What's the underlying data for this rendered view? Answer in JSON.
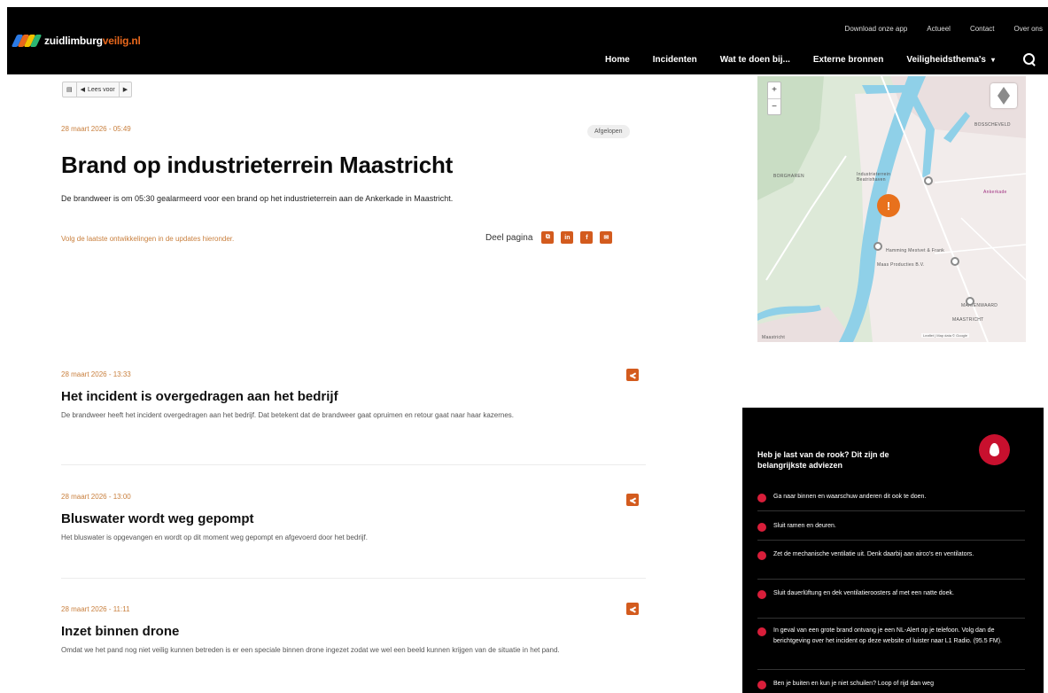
{
  "header": {
    "logo_main": "zuidlimburg",
    "logo_accent": "veilig.nl",
    "util_nav": [
      "Download onze app",
      "Actueel",
      "Contact",
      "Over ons"
    ],
    "main_nav": [
      "Home",
      "Incidenten",
      "Wat te doen bij...",
      "Externe bronnen",
      "Veiligheidsthema's"
    ]
  },
  "read_aloud": {
    "label": "Lees voor"
  },
  "article": {
    "date": "28 maart 2026 - 05:49",
    "status_tag": "Afgelopen",
    "title": "Brand op industrieterrein Maastricht",
    "lead": "De brandweer is om 05:30 gealarmeerd voor een brand op het industrieterrein aan de Ankerkade in Maastricht.",
    "follow_text": "Volg de laatste ontwikkelingen in de updates hieronder.",
    "share_label": "Deel pagina",
    "share_buttons": [
      "copy",
      "linkedin",
      "facebook",
      "mail"
    ]
  },
  "updates": [
    {
      "date": "28 maart 2026 - 13:33",
      "title": "Het incident is overgedragen aan het bedrijf",
      "text": "De brandweer heeft het incident overgedragen aan het bedrijf. Dat betekent dat de brandweer gaat opruimen en retour gaat naar haar kazernes."
    },
    {
      "date": "28 maart 2026 - 13:00",
      "title": "Bluswater wordt weg gepompt",
      "text": "Het bluswater is opgevangen en wordt op dit moment weg gepompt en afgevoerd door het bedrijf."
    },
    {
      "date": "28 maart 2026 - 11:11",
      "title": "Inzet binnen drone",
      "text": "Omdat we het pand nog niet veilig kunnen betreden is er een speciale binnen drone ingezet zodat we wel een beeld kunnen krijgen van de situatie in het pand."
    }
  ],
  "map": {
    "zoom_in": "+",
    "zoom_out": "−",
    "labels": [
      "BOSSCHEVELD",
      "BORGHAREN",
      "Maastricht",
      "Ankerkade",
      "MARIENWAARD",
      "MAASTRICHT"
    ],
    "pois": [
      "Industrieterrein Beatrixhaven",
      "Hamming Mestvet & Frank",
      "Maas Producties B.V."
    ],
    "attribution": "Leaflet | Map data © Google",
    "warning_symbol": "!"
  },
  "advice": {
    "title": "Heb je last van de rook? Dit zijn de belangrijkste adviezen",
    "items": [
      "Ga naar binnen en waarschuw anderen dit ook te doen.",
      "Sluit ramen en deuren.",
      "Zet de mechanische ventilatie uit. Denk daarbij aan airco's en ventilators.",
      "Sluit dauerlüftung en dek ventilatieroosters af met een natte doek.",
      "In geval van een grote brand ontvang je een NL-Alert op je telefoon. Volg dan de berichtgeving over het incident op deze website of luister naar L1 Radio. (95.5 FM).",
      "Ben je buiten en kun je niet schuilen? Loop of rijd dan weg"
    ]
  },
  "colors": {
    "accent": "#d35b1e",
    "date": "#c9803f",
    "alert_red": "#c8102e"
  }
}
